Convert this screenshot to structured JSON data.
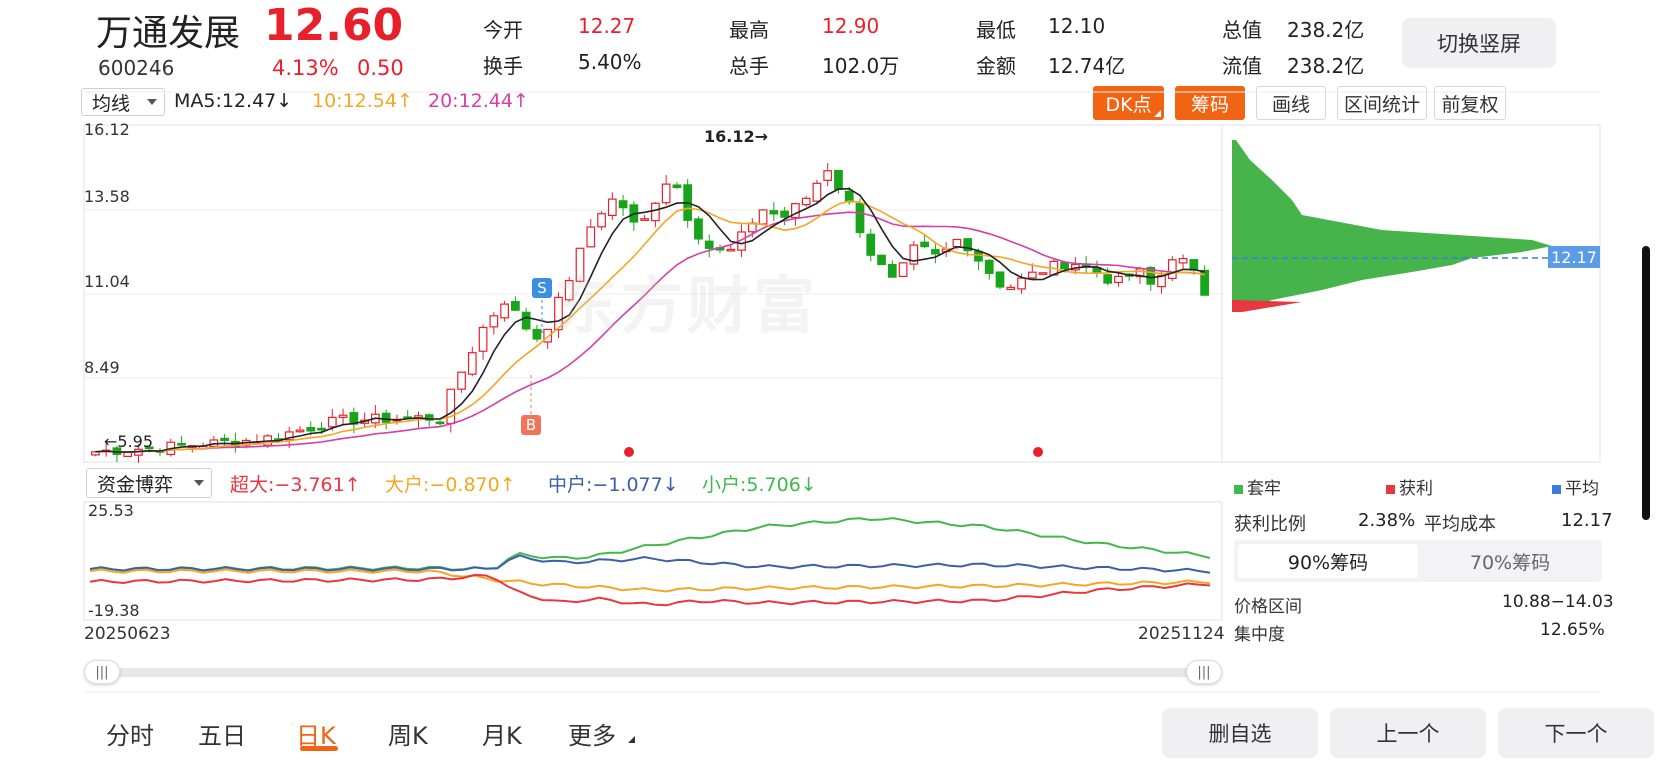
{
  "stock": {
    "name": "万通发展",
    "code": "600246",
    "price": "12.60",
    "change_pct": "4.13%",
    "change_amt": "0.50",
    "stats": [
      {
        "label": "今开",
        "value": "12.27",
        "red": true
      },
      {
        "label": "最高",
        "value": "12.90",
        "red": true
      },
      {
        "label": "最低",
        "value": "12.10",
        "red": false
      },
      {
        "label": "总值",
        "value": "238.2亿",
        "red": false
      },
      {
        "label": "换手",
        "value": "5.40%",
        "red": false
      },
      {
        "label": "总手",
        "value": "102.0万",
        "red": false
      },
      {
        "label": "金额",
        "value": "12.74亿",
        "red": false
      },
      {
        "label": "流值",
        "value": "238.2亿",
        "red": false
      }
    ]
  },
  "switch_label": "切换竖屏",
  "toolbar": {
    "ma_select": "均线",
    "ma5": "MA5:12.47↓",
    "ma10": "10:12.54↑",
    "ma20": "20:12.44↑",
    "dk_label": "DK点",
    "chouma_label": "筹码",
    "huaxian_label": "画线",
    "qujian_label": "区间统计",
    "fuquan_label": "前复权"
  },
  "kline": {
    "y_labels": [
      "16.12",
      "13.58",
      "11.04",
      "8.49"
    ],
    "high_marker": "16.12→",
    "low_marker": "←5.95",
    "s_marker": "S",
    "b_marker": "B",
    "cost_line_label": "12.17",
    "watermark": "东方财富"
  },
  "flow": {
    "select_label": "资金博弈",
    "chaoda": "超大:−3.761↑",
    "dahu": "大户:−0.870↑",
    "zhonghu": "中户:−1.077↓",
    "xiaohu": "小户:5.706↓",
    "y_top": "25.53",
    "y_bottom": "-19.38"
  },
  "dates": {
    "start": "20250623",
    "end": "20251124"
  },
  "chip": {
    "legend": [
      {
        "label": "套牢",
        "color": "#3fb94a"
      },
      {
        "label": "获利",
        "color": "#e8373f"
      },
      {
        "label": "平均",
        "color": "#3a7be0"
      }
    ],
    "profit_ratio_label": "获利比例",
    "profit_ratio": "2.38%",
    "avg_cost_label": "平均成本",
    "avg_cost": "12.17",
    "tab90": "90%筹码",
    "tab70": "70%筹码",
    "range_label": "价格区间",
    "range_value": "10.88−14.03",
    "conc_label": "集中度",
    "conc_value": "12.65%"
  },
  "bottom_tabs": [
    {
      "label": "分时"
    },
    {
      "label": "五日"
    },
    {
      "label": "日K"
    },
    {
      "label": "周K"
    },
    {
      "label": "月K"
    },
    {
      "label": "更多"
    }
  ],
  "bottom_buttons": {
    "del": "删自选",
    "prev": "上一个",
    "next": "下一个"
  },
  "colors": {
    "up": "#e8202b",
    "down": "#19a51b",
    "ma5": "#222222",
    "ma10": "#f5a623",
    "ma20": "#d63fa8",
    "chaoda": "#e8373f",
    "dahu": "#f5a623",
    "zhonghu": "#3d5fa8",
    "xiaohu": "#3fb94a",
    "accent": "#f06414"
  }
}
